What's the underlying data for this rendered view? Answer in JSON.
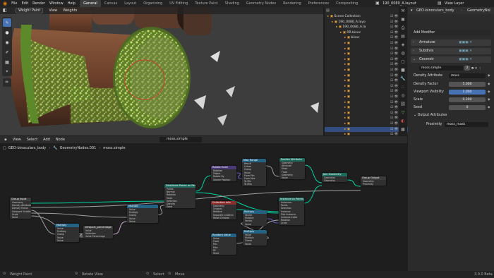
{
  "topbar": {
    "menus": [
      "File",
      "Edit",
      "Render",
      "Window",
      "Help"
    ],
    "workspaces": [
      "General",
      "Canvas",
      "Layout",
      "Organising",
      "UV Editing",
      "Texture Paint",
      "Shading",
      "Geometry Nodes",
      "Rendering",
      "Preferences",
      "Compositing"
    ],
    "active_workspace": "General",
    "scene_name": "190_0080_A.layout",
    "view_layer": "View Layer"
  },
  "viewport": {
    "mode": "Weight Paint",
    "menu": [
      "View",
      "Weights"
    ]
  },
  "outliner": {
    "rows": [
      {
        "label": "Scene Collection",
        "indent": 0,
        "selected": false
      },
      {
        "label": "190_0080_A.layo",
        "indent": 1,
        "selected": false
      },
      {
        "label": "190_0080_A.la",
        "indent": 2,
        "selected": false
      },
      {
        "label": "RR-binoc",
        "indent": 3,
        "selected": false
      },
      {
        "label": "binoc",
        "indent": 4,
        "selected": false
      },
      {
        "label": "",
        "indent": 4,
        "selected": false
      },
      {
        "label": "",
        "indent": 4,
        "selected": false
      },
      {
        "label": "",
        "indent": 4,
        "selected": false
      },
      {
        "label": "",
        "indent": 4,
        "selected": false
      },
      {
        "label": "",
        "indent": 4,
        "selected": false
      },
      {
        "label": "",
        "indent": 4,
        "selected": false
      },
      {
        "label": "",
        "indent": 4,
        "selected": false
      },
      {
        "label": "",
        "indent": 4,
        "selected": false
      },
      {
        "label": "",
        "indent": 4,
        "selected": false
      },
      {
        "label": "",
        "indent": 4,
        "selected": false
      },
      {
        "label": "",
        "indent": 4,
        "selected": false
      },
      {
        "label": "",
        "indent": 4,
        "selected": false
      },
      {
        "label": "",
        "indent": 4,
        "selected": false
      },
      {
        "label": "",
        "indent": 4,
        "selected": false
      },
      {
        "label": "",
        "indent": 4,
        "selected": false
      },
      {
        "label": "",
        "indent": 4,
        "selected": false
      },
      {
        "label": "",
        "indent": 4,
        "selected": true
      },
      {
        "label": "",
        "indent": 4,
        "selected": false
      }
    ]
  },
  "properties": {
    "object_name": "GEO-binoculars_body",
    "modifier_tab": "GeometryNo",
    "add_modifier": "Add Modifier",
    "modifiers": [
      "Armature",
      "Subdivis",
      "Geometr"
    ],
    "nodegroup": "moss.simple",
    "nodegroup_users": "2",
    "fields": [
      {
        "label": "Density Attribute",
        "value": "moss"
      },
      {
        "label": "Density Factor",
        "value": "5.000"
      },
      {
        "label": "Viewport Visibility",
        "value": "1.000"
      },
      {
        "label": "Scale",
        "value": "0.200"
      },
      {
        "label": "Seed",
        "value": "0"
      }
    ],
    "output_section": "Output Attributes",
    "proximity_label": "Proximity",
    "proximity_value": "moss_mask"
  },
  "node_editor": {
    "menu": [
      "View",
      "Select",
      "Add",
      "Node"
    ],
    "breadcrumb": [
      "GEO-binoculars_body",
      "GeometryNodes.001",
      "moss.simple"
    ],
    "nodegroup": "moss.simple"
  },
  "nodes": [
    {
      "id": "group_input",
      "title": "Group Input",
      "color": "#3b3b3b",
      "lines": [
        "Geometry",
        "Density Attribute",
        "Density Factor",
        "Viewport Visibility",
        "Scale",
        "Seed"
      ]
    },
    {
      "id": "multiply1",
      "title": "Multiply",
      "color": "#246283",
      "lines": [
        "Value",
        "Multiply",
        "Clamp",
        "Value",
        "Value"
      ]
    },
    {
      "id": "viewport_sel",
      "title": "viewport_percentage",
      "color": "#3b3b3b",
      "lines": [
        "Value",
        "Selection",
        "Value Percentage"
      ]
    },
    {
      "id": "multiply2",
      "title": "Multiply",
      "color": "#246283",
      "lines": [
        "Value",
        "Multiply",
        "Clamp",
        "Value",
        "Value"
      ]
    },
    {
      "id": "distribute",
      "title": "Distribute Points on Faces",
      "color": "#1e6b5c",
      "lines": [
        "Points",
        "Normal",
        "Rotation",
        "Mesh",
        "Selection",
        "Density",
        "Seed"
      ]
    },
    {
      "id": "rotate",
      "title": "Rotate Euler",
      "color": "#4b3a7a",
      "lines": [
        "Rotation",
        "Object",
        "Rotate By",
        "Source Position"
      ]
    },
    {
      "id": "map_range",
      "title": "Map Range",
      "color": "#246283",
      "lines": [
        "Result",
        "Linear",
        "Clamp",
        "Value",
        "From Min",
        "From Max",
        "To Min",
        "To Max"
      ]
    },
    {
      "id": "realize",
      "title": "Realize Attribute",
      "color": "#1e6b5c",
      "lines": [
        "Geometry",
        "Attribute",
        "Mesh",
        "Float",
        "Geometry",
        "Value"
      ]
    },
    {
      "id": "join",
      "title": "Join Geometry",
      "color": "#1e6b5c",
      "lines": [
        "Geometry",
        "Geometry"
      ]
    },
    {
      "id": "group_output",
      "title": "Group Output",
      "color": "#3b3b3b",
      "lines": [
        "Geometry",
        "Proximity"
      ]
    },
    {
      "id": "collection_info",
      "title": "Collection Info",
      "color": "#8b2e2e",
      "lines": [
        "Geometry",
        "Original",
        "Relative",
        "Separate Children",
        "Reset Children"
      ]
    },
    {
      "id": "instance",
      "title": "Instance on Points",
      "color": "#1e6b5c",
      "lines": [
        "Instances",
        "Points",
        "Selection",
        "Instance",
        "Pick Instance",
        "Instance Index",
        "Rotation",
        "Scale"
      ]
    },
    {
      "id": "random_value",
      "title": "Random Value",
      "color": "#246283",
      "lines": [
        "Value",
        "Float",
        "Min",
        "Max",
        "ID",
        "Seed"
      ]
    },
    {
      "id": "multiply3",
      "title": "Multiply",
      "color": "#246283",
      "lines": [
        "Vector",
        "Multiply",
        "Vector",
        "Value"
      ]
    },
    {
      "id": "multiply4",
      "title": "Multiply",
      "color": "#246283",
      "lines": [
        "Value",
        "Multiply",
        "Clamp",
        "Value"
      ]
    }
  ],
  "statusbar": {
    "left": "Weight Paint",
    "mid": "Rotate View",
    "select": "Select",
    "move": "Move",
    "version": "3.0.0 Beta"
  }
}
